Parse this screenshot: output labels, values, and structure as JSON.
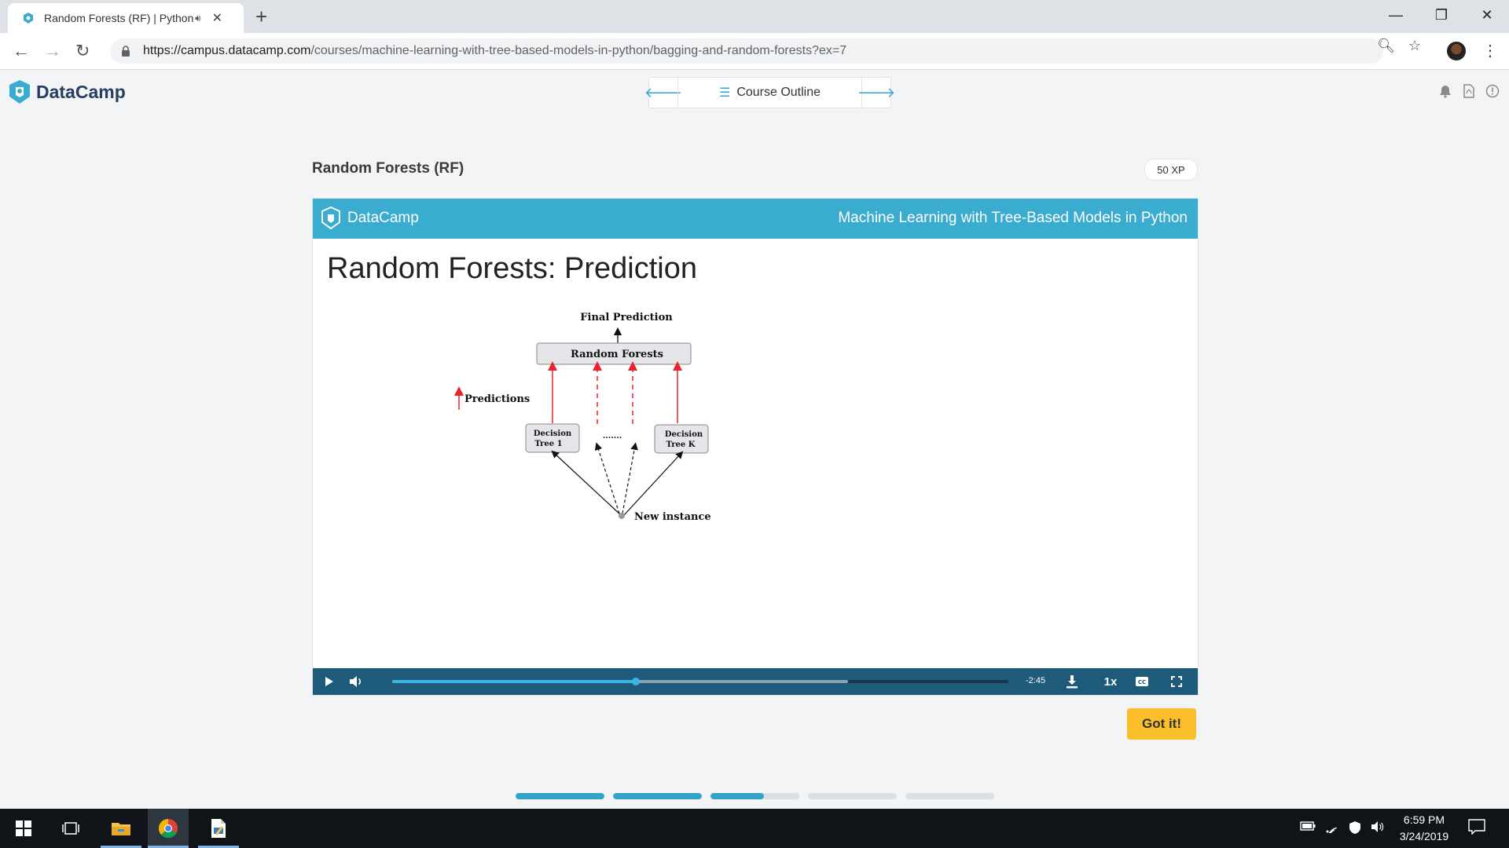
{
  "browser": {
    "tab_title": "Random Forests (RF) | Python",
    "url_host": "https://campus.datacamp.com",
    "url_path": "/courses/machine-learning-with-tree-based-models-in-python/bagging-and-random-forests?ex=7"
  },
  "header": {
    "logo_text": "DataCamp",
    "course_outline_label": "Course Outline"
  },
  "exercise": {
    "title": "Random Forests (RF)",
    "xp": "50 XP"
  },
  "slide": {
    "brand": "DataCamp",
    "course_name": "Machine Learning with Tree-Based Models in Python",
    "title": "Random Forests: Prediction",
    "diagram": {
      "final_prediction": "Final Prediction",
      "random_forests": "Random Forests",
      "predictions": "Predictions",
      "tree1_line1": "Decision",
      "tree1_line2": "Tree 1",
      "treek_line1": "Decision",
      "treek_line2": "Tree K",
      "ellipsis": ".......",
      "new_instance": "New instance"
    }
  },
  "player": {
    "time_remaining": "-2:45",
    "speed": "1x",
    "progress_fraction": 0.395,
    "buffer_fraction": 0.74
  },
  "actions": {
    "got_it_label": "Got it!"
  },
  "course_progress": [
    1,
    1,
    0.6,
    0,
    0
  ],
  "taskbar": {
    "time": "6:59 PM",
    "date": "3/24/2019"
  },
  "colors": {
    "brand_blue": "#3aaccf",
    "player_bar": "#1e5a79",
    "got_it_yellow": "#fbbf2b",
    "arrow_red": "#e8242c"
  }
}
